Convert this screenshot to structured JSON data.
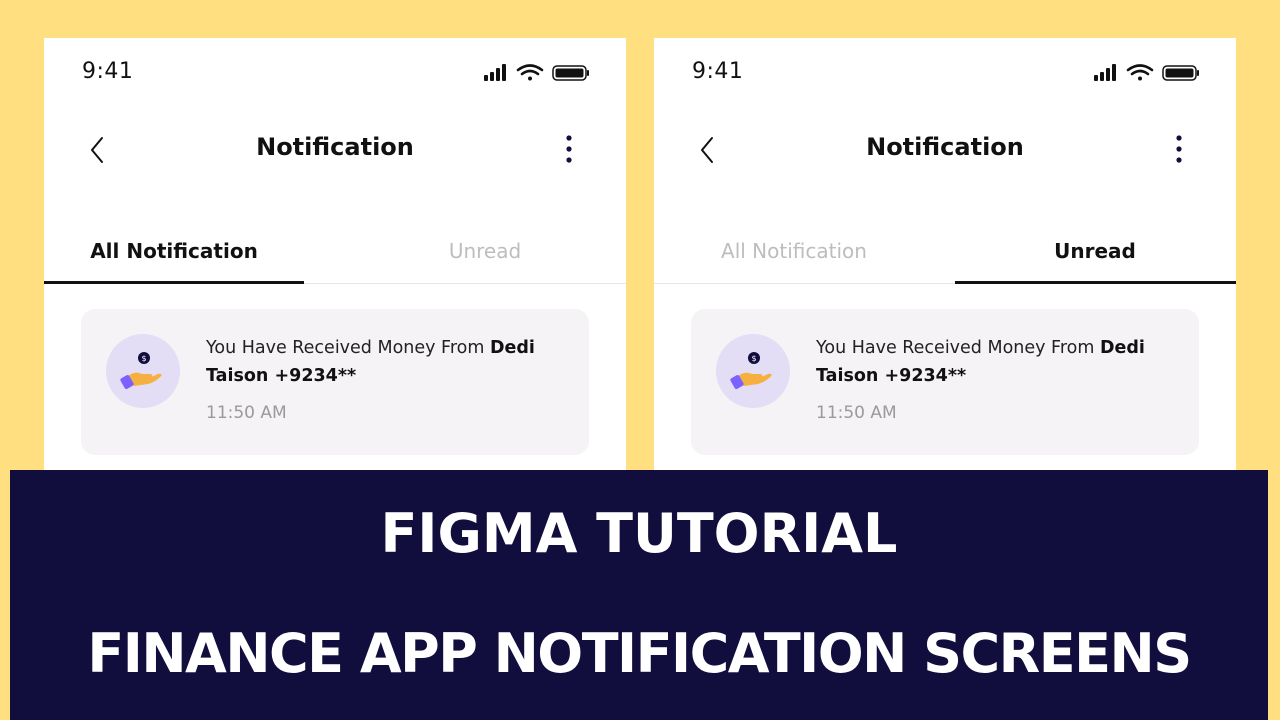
{
  "screens": [
    {
      "status_time": "9:41",
      "header_title": "Notification",
      "tabs": [
        {
          "label": "All Notification",
          "active": true
        },
        {
          "label": "Unread",
          "active": false
        }
      ],
      "notification": {
        "message_prefix": "You Have Received Money From ",
        "message_bold": "Dedi Taison +9234**",
        "time": "11:50 AM",
        "icon": "hand-coin-icon"
      }
    },
    {
      "status_time": "9:41",
      "header_title": "Notification",
      "tabs": [
        {
          "label": "All Notification",
          "active": false
        },
        {
          "label": "Unread",
          "active": true
        }
      ],
      "notification": {
        "message_prefix": "You Have Received Money From ",
        "message_bold": "Dedi Taison +9234**",
        "time": "11:50 AM",
        "icon": "hand-coin-icon"
      }
    }
  ],
  "banner": {
    "line1": "FIGMA TUTORIAL",
    "line2": "FINANCE APP NOTIFICATION SCREENS"
  },
  "colors": {
    "background": "#FFDF80",
    "banner": "#110D3D",
    "card": "#F5F3F5",
    "avatar": "#E3DDF5",
    "inactive_tab": "#BDBDBD"
  }
}
